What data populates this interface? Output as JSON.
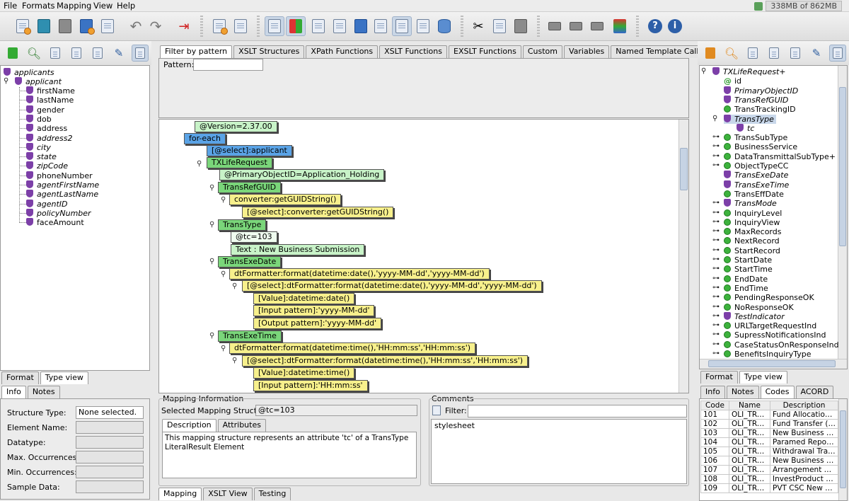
{
  "menu": [
    "File",
    "Formats",
    "Mapping",
    "View",
    "Help"
  ],
  "memory": "338MB of 862MB",
  "left_tree": {
    "root": "applicants",
    "child": "applicant",
    "fields": [
      "firstName",
      "lastName",
      "gender",
      "dob",
      "address",
      "address2",
      "city",
      "state",
      "zipCode",
      "phoneNumber",
      "agentFirstName",
      "agentLastName",
      "agentID",
      "policyNumber",
      "faceAmount"
    ],
    "italic": [
      false,
      false,
      false,
      false,
      false,
      true,
      true,
      true,
      true,
      false,
      true,
      true,
      true,
      true,
      false
    ]
  },
  "left_bottom_tabs": [
    "Format",
    "Type view"
  ],
  "info_tabs": [
    "Info",
    "Notes"
  ],
  "info_labels": [
    "Structure Type:",
    "Element Name:",
    "Datatype:",
    "Max. Occurrences:",
    "Min. Occurrences:",
    "Sample Data:"
  ],
  "info_values": [
    "None selected.",
    "",
    "",
    "",
    "",
    ""
  ],
  "center_tabs": [
    "Filter by pattern",
    "XSLT Structures",
    "XPath Functions",
    "XSLT Functions",
    "EXSLT Functions",
    "Custom",
    "Variables",
    "Named Template Calls",
    ".."
  ],
  "pattern_label": "Pattern:",
  "pattern_value": "",
  "mapping_nodes": [
    {
      "text": "@Version=2.37.00",
      "style": "lg"
    },
    {
      "text": "for-each",
      "style": "b"
    },
    {
      "text": "[@select]:applicant",
      "style": "b"
    },
    {
      "text": "TXLifeRequest",
      "style": "g"
    },
    {
      "text": "@PrimaryObjectID=Application_Holding",
      "style": "lg"
    },
    {
      "text": "TransRefGUID",
      "style": "g"
    },
    {
      "text": "converter:getGUIDString()",
      "style": "y"
    },
    {
      "text": "[@select]:converter:getGUIDString()",
      "style": "y"
    },
    {
      "text": "TransType",
      "style": "g"
    },
    {
      "text": "@tc=103",
      "style": "w"
    },
    {
      "text": "Text : New Business Submission",
      "style": "lg"
    },
    {
      "text": "TransExeDate",
      "style": "g"
    },
    {
      "text": "dtFormatter:format(datetime:date(),'yyyy-MM-dd','yyyy-MM-dd')",
      "style": "y"
    },
    {
      "text": "[@select]:dtFormatter:format(datetime:date(),'yyyy-MM-dd','yyyy-MM-dd')",
      "style": "y"
    },
    {
      "text": "[Value]:datetime:date()",
      "style": "y"
    },
    {
      "text": "[Input pattern]:'yyyy-MM-dd'",
      "style": "y"
    },
    {
      "text": "[Output pattern]:'yyyy-MM-dd'",
      "style": "y"
    },
    {
      "text": "TransExeTime",
      "style": "g"
    },
    {
      "text": "dtFormatter:format(datetime:time(),'HH:mm:ss','HH:mm:ss')",
      "style": "y"
    },
    {
      "text": "[@select]:dtFormatter:format(datetime:time(),'HH:mm:ss','HH:mm:ss')",
      "style": "y"
    },
    {
      "text": "[Value]:datetime:time()",
      "style": "y"
    },
    {
      "text": "[Input pattern]:'HH:mm:ss'",
      "style": "y"
    }
  ],
  "mapping_info": {
    "title": "Mapping Information",
    "selected_label": "Selected Mapping Structure:",
    "selected_value": "@tc=103",
    "tabs": [
      "Description",
      "Attributes"
    ],
    "description": "This mapping structure represents an attribute 'tc' of a TransType LiteralResult Element"
  },
  "comments": {
    "title": "Comments",
    "filter_label": "Filter:",
    "filter_value": "",
    "text": "stylesheet"
  },
  "bottom_tabs": [
    "Mapping",
    "XSLT View",
    "Testing"
  ],
  "right_tree": [
    {
      "text": "TXLifeRequest+",
      "icon": "shield",
      "italic": true,
      "level": 0
    },
    {
      "text": "id",
      "icon": "at",
      "italic": false,
      "level": 1
    },
    {
      "text": "PrimaryObjectID",
      "icon": "shield",
      "italic": true,
      "level": 1
    },
    {
      "text": "TransRefGUID",
      "icon": "shield",
      "italic": true,
      "level": 1
    },
    {
      "text": "TransTrackingID",
      "icon": "green",
      "italic": false,
      "level": 1
    },
    {
      "text": "TransType",
      "icon": "shield",
      "italic": true,
      "level": 1
    },
    {
      "text": "tc",
      "icon": "shield",
      "italic": true,
      "level": 2
    },
    {
      "text": "TransSubType",
      "icon": "green",
      "italic": false,
      "level": 1
    },
    {
      "text": "BusinessService",
      "icon": "green",
      "italic": false,
      "level": 1
    },
    {
      "text": "DataTransmittalSubType+",
      "icon": "green",
      "italic": false,
      "level": 1
    },
    {
      "text": "ObjectTypeCC",
      "icon": "green",
      "italic": false,
      "level": 1
    },
    {
      "text": "TransExeDate",
      "icon": "shield",
      "italic": true,
      "level": 1
    },
    {
      "text": "TransExeTime",
      "icon": "shield",
      "italic": true,
      "level": 1
    },
    {
      "text": "TransEffDate",
      "icon": "green",
      "italic": false,
      "level": 1
    },
    {
      "text": "TransMode",
      "icon": "shield",
      "italic": true,
      "level": 1
    },
    {
      "text": "InquiryLevel",
      "icon": "green",
      "italic": false,
      "level": 1
    },
    {
      "text": "InquiryView",
      "icon": "green",
      "italic": false,
      "level": 1
    },
    {
      "text": "MaxRecords",
      "icon": "green",
      "italic": false,
      "level": 1
    },
    {
      "text": "NextRecord",
      "icon": "green",
      "italic": false,
      "level": 1
    },
    {
      "text": "StartRecord",
      "icon": "green",
      "italic": false,
      "level": 1
    },
    {
      "text": "StartDate",
      "icon": "green",
      "italic": false,
      "level": 1
    },
    {
      "text": "StartTime",
      "icon": "green",
      "italic": false,
      "level": 1
    },
    {
      "text": "EndDate",
      "icon": "green",
      "italic": false,
      "level": 1
    },
    {
      "text": "EndTime",
      "icon": "green",
      "italic": false,
      "level": 1
    },
    {
      "text": "PendingResponseOK",
      "icon": "green",
      "italic": false,
      "level": 1
    },
    {
      "text": "NoResponseOK",
      "icon": "green",
      "italic": false,
      "level": 1
    },
    {
      "text": "TestIndicator",
      "icon": "shield",
      "italic": true,
      "level": 1
    },
    {
      "text": "URLTargetRequestInd",
      "icon": "green",
      "italic": false,
      "level": 1
    },
    {
      "text": "SupressNotificationsInd",
      "icon": "green",
      "italic": false,
      "level": 1
    },
    {
      "text": "CaseStatusOnResponseInd",
      "icon": "green",
      "italic": false,
      "level": 1
    },
    {
      "text": "BenefitsInquiryType",
      "icon": "green",
      "italic": false,
      "level": 1
    }
  ],
  "right_bottom_tabs": [
    "Format",
    "Type view"
  ],
  "right_info_tabs": [
    "Info",
    "Notes",
    "Codes",
    "ACORD"
  ],
  "codes_table": {
    "headers": [
      "Code",
      "Name",
      "Description"
    ],
    "rows": [
      [
        "101",
        "OLI_TRA...",
        "Fund Allocation ..."
      ],
      [
        "102",
        "OLI_TRA...",
        "Fund Transfer (o..."
      ],
      [
        "103",
        "OLI_TRA...",
        "New Business Su..."
      ],
      [
        "104",
        "OLI_TRA...",
        "Paramed Report..."
      ],
      [
        "105",
        "OLI_TRA...",
        "Withdrawal Tran..."
      ],
      [
        "106",
        "OLI_TRA...",
        "New Business Po..."
      ],
      [
        "107",
        "OLI_TRA...",
        "Arrangement Ad..."
      ],
      [
        "108",
        "OLI_TRA...",
        "InvestProduct Ch..."
      ],
      [
        "109",
        "OLI_TRA...",
        "PVT CSC New Bu..."
      ]
    ]
  }
}
